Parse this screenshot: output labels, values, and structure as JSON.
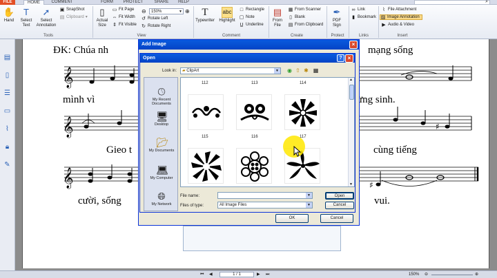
{
  "tabs": [
    {
      "label": "FILE"
    },
    {
      "label": "HOME"
    },
    {
      "label": "COMMENT"
    },
    {
      "label": "FORM"
    },
    {
      "label": "PROTECT"
    },
    {
      "label": "SHARE"
    },
    {
      "label": "HELP"
    }
  ],
  "ribbon": {
    "hand": "Hand",
    "select_text": "Select\nText",
    "select_annotation": "Select\nAnnotation",
    "snapshot": "SnapShot",
    "clipboard": "Clipboard",
    "actual_size": "Actual\nSize",
    "fit_page": "Fit Page",
    "fit_width": "Fit Width",
    "fit_visible": "Fit Visible",
    "zoom": "150%",
    "rotate_left": "Rotate Left",
    "rotate_right": "Rotate Right",
    "typewriter": "Typewriter",
    "highlight": "Highlight",
    "rectangle": "Rectangle",
    "note": "Note",
    "underline": "Underline",
    "from_file": "From\nFile",
    "from_scanner": "From Scanner",
    "blank": "Blank",
    "from_clipboard": "From Clipboard",
    "pdf_sign": "PDF\nSign",
    "link": "Link",
    "bookmark": "Bookmark",
    "file_attachment": "File Attachment",
    "image_annotation": "Image Annotation",
    "audio_video": "Audio & Video",
    "groups": {
      "tools": "Tools",
      "view": "View",
      "comment": "Comment",
      "create": "Create",
      "protect": "Protect",
      "links": "Links",
      "insert": "Insert"
    }
  },
  "document": {
    "lyrics": [
      {
        "text": "ĐK: Chúa    nh"
      },
      {
        "text": "mạng    sống"
      },
      {
        "text": "mình      vì"
      },
      {
        "text": "ừng       sinh."
      },
      {
        "text": "Gieo    t"
      },
      {
        "text": "cùng    tiếng"
      },
      {
        "text": "cười,     sống"
      },
      {
        "text": "vui."
      }
    ]
  },
  "add_image_dialog": {
    "title": "Add Image",
    "ok": "OK",
    "cancel": "Cancel"
  },
  "open_dialog": {
    "title": "Open",
    "look_in_label": "Look in:",
    "look_in_value": "ClipArt",
    "places": [
      {
        "label": "My Recent\nDocuments",
        "icon": "recent-documents-icon"
      },
      {
        "label": "Desktop",
        "icon": "desktop-icon"
      },
      {
        "label": "My Documents",
        "icon": "my-documents-icon"
      },
      {
        "label": "My Computer",
        "icon": "my-computer-icon"
      },
      {
        "label": "My Network",
        "icon": "my-network-icon"
      }
    ],
    "files": [
      {
        "num": "112"
      },
      {
        "num": "113"
      },
      {
        "num": "114"
      },
      {
        "num": "115"
      },
      {
        "num": "116"
      },
      {
        "num": "117"
      }
    ],
    "file_name_label": "File name:",
    "file_name_value": "",
    "file_type_label": "Files of type:",
    "file_type_value": "All Image Files",
    "open_button": "Open",
    "cancel_button": "Cancel"
  },
  "status_bar": {
    "page_nav": "1 / 1",
    "zoom": "150%"
  },
  "colors": {
    "file_tab": "#e34f26",
    "xp_title": "#0a5bde",
    "cursor_highlight": "#ffe800"
  }
}
